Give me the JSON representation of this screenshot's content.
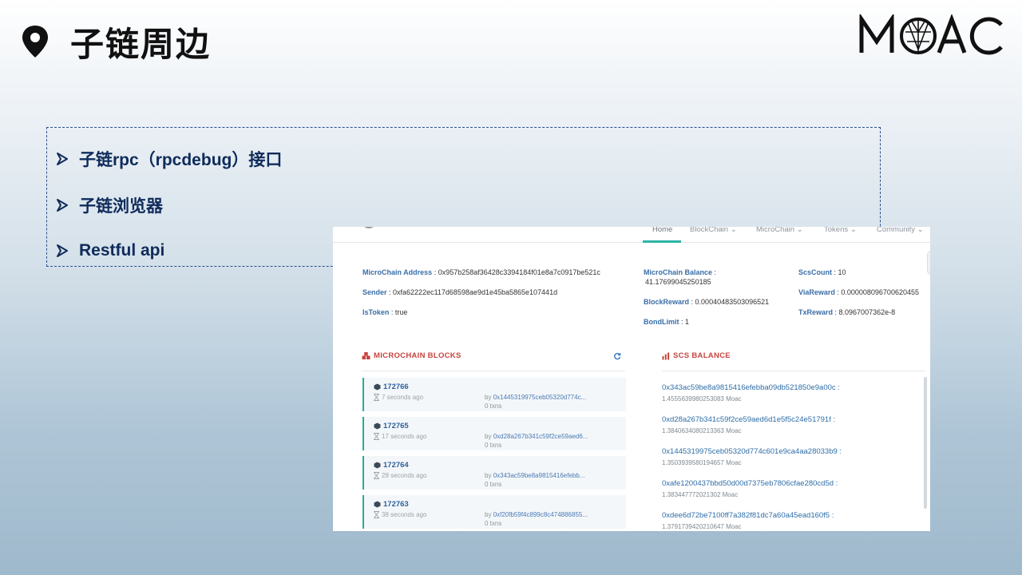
{
  "slide": {
    "title": "子链周边",
    "logo_text": "MOAC"
  },
  "bullets": [
    {
      "label": "子链rpc（rpcdebug）接口"
    },
    {
      "label": "子链浏览器"
    },
    {
      "label": "Restful api"
    }
  ],
  "explorer": {
    "nav": [
      {
        "label": "Home"
      },
      {
        "label": "BlockChain"
      },
      {
        "label": "MicroChain"
      },
      {
        "label": "Tokens"
      },
      {
        "label": "Community"
      }
    ],
    "info_left": [
      {
        "key": "MicroChain Address",
        "value": "0x957b258af36428c3394184f01e8a7c0917be521c"
      },
      {
        "key": "Sender",
        "value": "0xfa62222ec117d68598ae9d1e45ba5865e107441d"
      },
      {
        "key": "IsToken",
        "value": "true"
      }
    ],
    "info_mid": {
      "balance_key": "MicroChain Balance",
      "balance_value": "41.17699045250185",
      "block_reward_key": "BlockReward",
      "block_reward_value": "0.00040483503096521",
      "bond_limit_key": "BondLimit",
      "bond_limit_value": "1"
    },
    "info_right": [
      {
        "key": "ScsCount",
        "value": "10"
      },
      {
        "key": "ViaReward",
        "value": "0.000008096700620455"
      },
      {
        "key": "TxReward",
        "value": "8.0967007362e-8"
      }
    ],
    "blocks_title": "MICROCHAIN BLOCKS",
    "scs_title": "SCS BALANCE",
    "blocks": [
      {
        "number": "172766",
        "age": "7 seconds ago",
        "by_prefix": "by",
        "miner": "0x1445319975ceb05320d774c...",
        "txns": "0 txns"
      },
      {
        "number": "172765",
        "age": "17 seconds ago",
        "by_prefix": "by",
        "miner": "0xd28a267b341c59f2ce59aed6...",
        "txns": "0 txns"
      },
      {
        "number": "172764",
        "age": "28 seconds ago",
        "by_prefix": "by",
        "miner": "0x343ac59be8a9815416efebb...",
        "txns": "0 txns"
      },
      {
        "number": "172763",
        "age": "38 seconds ago",
        "by_prefix": "by",
        "miner": "0xf20fb59f4c899c8c474886855...",
        "txns": "0 txns"
      }
    ],
    "scs": [
      {
        "address": "0x343ac59be8a9815416efebba09db521850e9a00c :",
        "balance": "1.4555639980253083 Moac"
      },
      {
        "address": "0xd28a267b341c59f2ce59aed6d1e5f5c24e51791f :",
        "balance": "1.3840634080213363 Moac"
      },
      {
        "address": "0x1445319975ceb05320d774c601e9ca4aa28033b9 :",
        "balance": "1.3503939580194657 Moac"
      },
      {
        "address": "0xafe1200437bbd50d00d7375eb7806cfae280cd5d :",
        "balance": "1.383447772021302 Moac"
      },
      {
        "address": "0xdee6d72be7100ff7a382f81dc7a60a45ead160f5 :",
        "balance": "1.3791739420210647 Moac"
      }
    ]
  }
}
